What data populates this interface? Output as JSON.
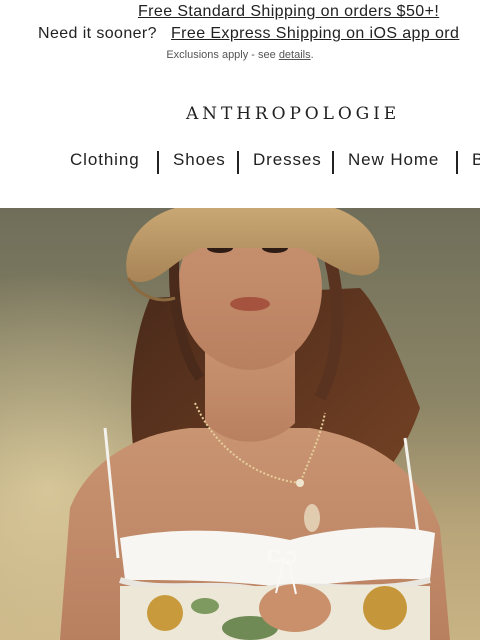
{
  "promo": {
    "line1_link": "Free Standard Shipping on orders $50+!",
    "line2_lead": "Need it sooner?",
    "line2_link": "Free Express Shipping on iOS app ord",
    "exclusions_text": "Exclusions apply - see ",
    "exclusions_link": "details",
    "exclusions_end": "."
  },
  "brand": {
    "logo": "ANTHROPOLOGIE"
  },
  "nav": {
    "items": [
      "Clothing",
      "Shoes",
      "Dresses",
      "New Home",
      "B"
    ]
  },
  "colors": {
    "text": "#222222",
    "background": "#ffffff"
  }
}
